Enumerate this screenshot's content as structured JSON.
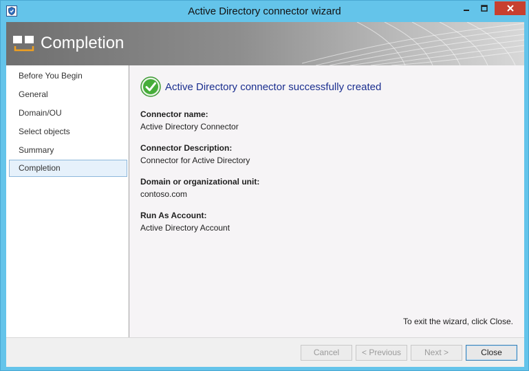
{
  "window": {
    "title": "Active Directory connector wizard"
  },
  "banner": {
    "title": "Completion"
  },
  "nav": {
    "items": [
      {
        "label": "Before You Begin"
      },
      {
        "label": "General"
      },
      {
        "label": "Domain/OU"
      },
      {
        "label": "Select objects"
      },
      {
        "label": "Summary"
      },
      {
        "label": "Completion",
        "selected": true
      }
    ]
  },
  "content": {
    "success_message": "Active Directory connector successfully created",
    "fields": [
      {
        "label": "Connector name:",
        "value": "Active Directory Connector"
      },
      {
        "label": "Connector Description:",
        "value": "Connector for Active Directory"
      },
      {
        "label": "Domain or organizational unit:",
        "value": "contoso.com"
      },
      {
        "label": "Run As Account:",
        "value": "Active Directory Account"
      }
    ],
    "exit_hint": "To exit the wizard, click Close."
  },
  "buttons": {
    "cancel": "Cancel",
    "previous": "< Previous",
    "next": "Next >",
    "close": "Close"
  },
  "colors": {
    "window_frame": "#64c4ea",
    "close_button": "#c7402f",
    "success_text": "#1a2e8f",
    "success_icon": "#3aa52e"
  },
  "icons": {
    "app": "shield-app-icon",
    "banner": "wizard-windows-icon",
    "success": "check-circle-icon"
  }
}
